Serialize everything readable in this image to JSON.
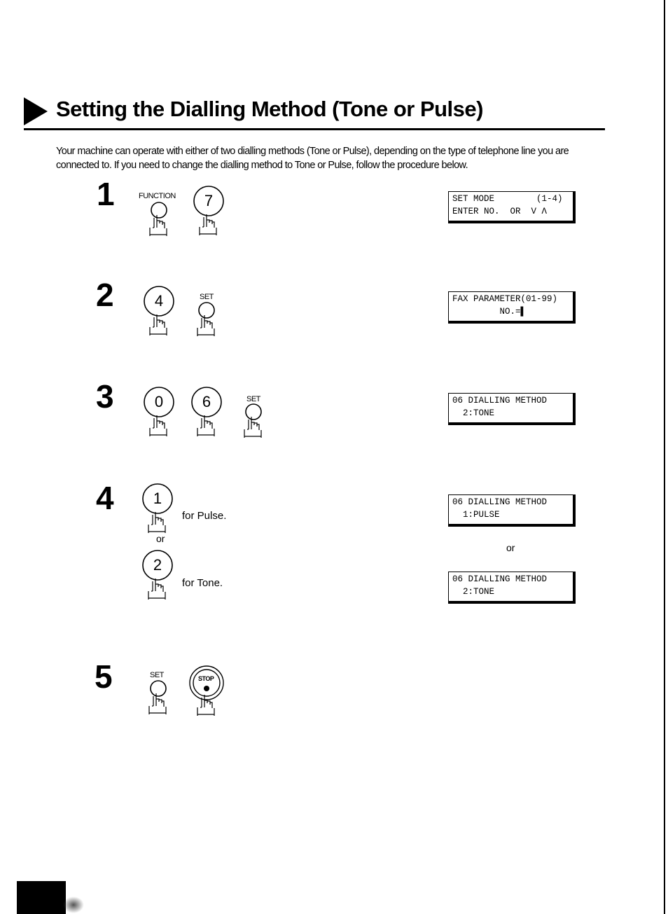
{
  "title": "Setting the Dialling Method (Tone or Pulse)",
  "intro": "Your machine can operate with either of two dialling methods (Tone or Pulse), depending on the type of telephone line you are connected to.  If you need to change the dialling method to Tone or Pulse, follow the procedure below.",
  "steps": [
    {
      "number": "1",
      "keys": [
        {
          "label": "FUNCTION"
        },
        {
          "label": "7"
        }
      ],
      "display": [
        "SET MODE        (1-4)",
        "ENTER NO.  OR  V Λ"
      ]
    },
    {
      "number": "2",
      "keys": [
        {
          "label": "4"
        },
        {
          "label": "SET"
        }
      ],
      "display": [
        "FAX PARAMETER(01-99)",
        "         NO.=▌"
      ]
    },
    {
      "number": "3",
      "keys": [
        {
          "label": "0"
        },
        {
          "label": "6"
        },
        {
          "label": "SET"
        }
      ],
      "display": [
        "06 DIALLING METHOD",
        "  2:TONE"
      ]
    },
    {
      "number": "4",
      "keys": [
        {
          "label": "1",
          "text": "for Pulse."
        },
        {
          "label": "2",
          "text": "for Tone."
        }
      ],
      "or": "or",
      "display": [
        "06 DIALLING METHOD",
        "  1:PULSE"
      ],
      "display_or": "or",
      "display_alt": [
        "06 DIALLING METHOD",
        "  2:TONE"
      ]
    },
    {
      "number": "5",
      "keys": [
        {
          "label": "SET"
        },
        {
          "label": "STOP"
        }
      ]
    }
  ]
}
